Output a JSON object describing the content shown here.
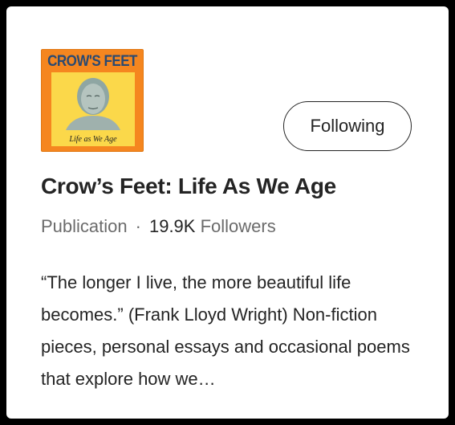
{
  "logo": {
    "title": "CROW'S FEET",
    "subtitle": "Life as We Age",
    "colors": {
      "background": "#f5861f",
      "inner": "#fbd84a",
      "title": "#2a4a72"
    }
  },
  "follow_button": {
    "label": "Following"
  },
  "publication": {
    "title": "Crow’s Feet: Life As We Age",
    "type_label": "Publication",
    "separator": "·",
    "followers_count": "19.9K",
    "followers_label": "Followers",
    "description": "“The longer I live, the more beautiful life becomes.” (Frank Lloyd Wright) Non-fiction pieces, personal essays and occasional poems that explore how we…"
  }
}
